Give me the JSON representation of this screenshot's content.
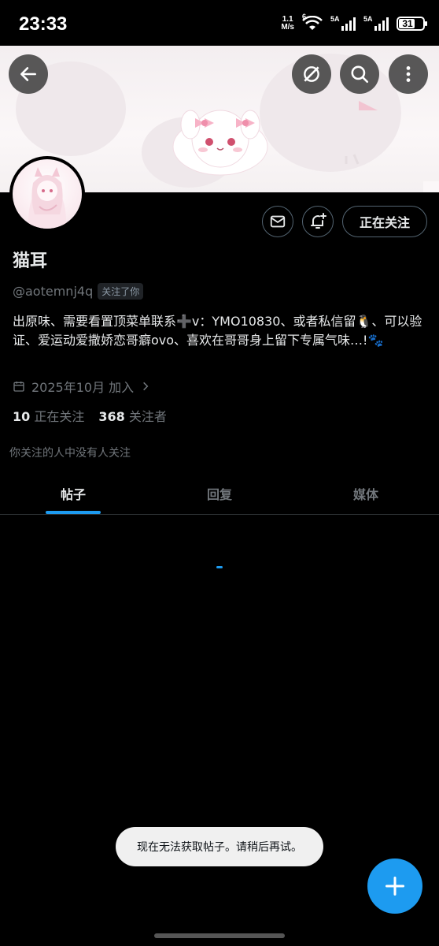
{
  "status_bar": {
    "time": "23:33",
    "net_speed_value": "1.1",
    "net_speed_unit": "M/s",
    "wifi_label": "6",
    "sim1_label": "5A",
    "sim2_label": "5A",
    "battery": "31"
  },
  "header": {
    "back_icon": "arrow-left-icon",
    "grok_icon": "grok-icon",
    "search_icon": "search-icon",
    "more_icon": "more-vertical-icon"
  },
  "profile": {
    "display_name": "猫耳",
    "handle": "@aotemnj4q",
    "follows_you": "关注了你",
    "bio": "出原味、需要看置顶菜单联系➕v：YMO10830、或者私信留🐧、可以验证、爱运动爱撒娇恋哥癖ovo、喜欢在哥哥身上留下专属气味…!🐾",
    "joined": "2025年10月 加入",
    "following_count": "10",
    "following_label": "正在关注",
    "followers_count": "368",
    "followers_label": "关注者",
    "followers_you_know": "你关注的人中没有人关注",
    "following_button": "正在关注"
  },
  "tabs": [
    {
      "label": "帖子",
      "active": true
    },
    {
      "label": "回复",
      "active": false
    },
    {
      "label": "媒体",
      "active": false
    }
  ],
  "toast": "现在无法获取帖子。请稍后再试。",
  "colors": {
    "accent": "#1d9bf0",
    "background": "#000000",
    "muted_text": "#71767b"
  }
}
